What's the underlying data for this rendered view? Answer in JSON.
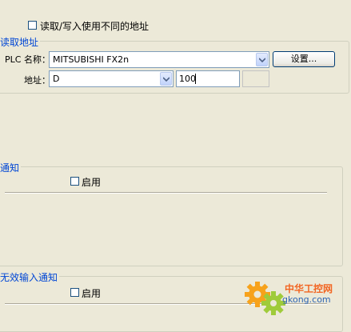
{
  "top": {
    "different_address_label": "读取/写入使用不同的地址"
  },
  "read_address": {
    "title": "读取地址",
    "plc_name_label": "PLC 名称：",
    "plc_name_value": "MITSUBISHI FX2n",
    "settings_button": "设置...",
    "address_label": "地址：",
    "device_value": "D",
    "address_value": "100"
  },
  "notify": {
    "title": "通知",
    "enable_label": "启用"
  },
  "invalid_input_notify": {
    "title": "无效输入通知",
    "enable_label": "启用"
  },
  "watermark": {
    "text_cn": "中华工控网",
    "text_url": "gkong.com"
  }
}
